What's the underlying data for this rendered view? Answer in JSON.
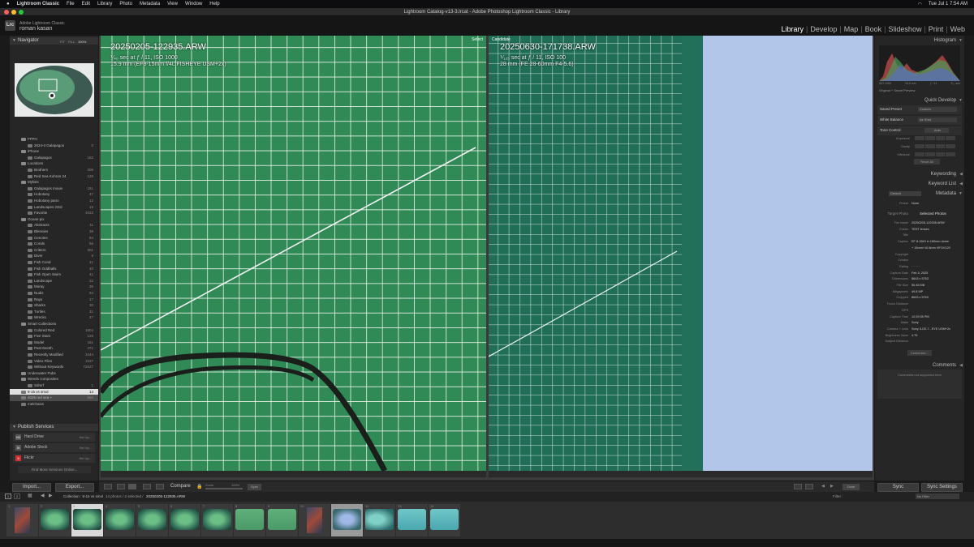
{
  "menubar": {
    "app": "Lightroom Classic",
    "items": [
      "File",
      "Edit",
      "Library",
      "Photo",
      "Metadata",
      "View",
      "Window",
      "Help"
    ],
    "clock": "Tue Jul 1  7:54 AM"
  },
  "window": {
    "title": "Lightroom Catalog-v13-3.lrcat - Adobe Photoshop Lightroom Classic - Library"
  },
  "identity": {
    "line1": "Adobe Lightroom Classic",
    "line2": "roman kasan"
  },
  "modules": [
    "Library",
    "Develop",
    "Map",
    "Book",
    "Slideshow",
    "Print",
    "Web"
  ],
  "active_module": "Library",
  "navigator": {
    "title": "Navigator",
    "zoom_opts": [
      "FIT",
      "FILL",
      "100%"
    ]
  },
  "collections": [
    {
      "label": "FFPH",
      "count": "",
      "indent": 1,
      "folder": true
    },
    {
      "label": "2024-II Galapagos",
      "count": "0",
      "indent": 2
    },
    {
      "label": "iPhone",
      "count": "",
      "indent": 1,
      "folder": true
    },
    {
      "label": "Galapagos",
      "count": "182",
      "indent": 2
    },
    {
      "label": "Locations",
      "count": "",
      "indent": 1,
      "folder": true
    },
    {
      "label": "Brothers",
      "count": "306",
      "indent": 2
    },
    {
      "label": "Red Sea Kohran 24",
      "count": "128",
      "indent": 2
    },
    {
      "label": "Mylists",
      "count": "",
      "indent": 1,
      "folder": true
    },
    {
      "label": "Galapagos movie",
      "count": "151",
      "indent": 2
    },
    {
      "label": "Hobotany",
      "count": "47",
      "indent": 2
    },
    {
      "label": "Hobotany pano",
      "count": "12",
      "indent": 2
    },
    {
      "label": "Landscapes 23rd",
      "count": "19",
      "indent": 2
    },
    {
      "label": "Favorite",
      "count": "4022",
      "indent": 2
    },
    {
      "label": "Ocean-pix",
      "count": "",
      "indent": 1,
      "folder": true
    },
    {
      "label": "Abstracts",
      "count": "11",
      "indent": 2
    },
    {
      "label": "Blennies",
      "count": "38",
      "indent": 2
    },
    {
      "label": "Cenotes",
      "count": "84",
      "indent": 2
    },
    {
      "label": "Corals",
      "count": "56",
      "indent": 2
    },
    {
      "label": "Critters",
      "count": "301",
      "indent": 2
    },
    {
      "label": "Diver",
      "count": "9",
      "indent": 2
    },
    {
      "label": "Fish Coral",
      "count": "41",
      "indent": 2
    },
    {
      "label": "Fish Oddballs",
      "count": "40",
      "indent": 2
    },
    {
      "label": "Fish Open Swim",
      "count": "41",
      "indent": 2
    },
    {
      "label": "Landscape",
      "count": "22",
      "indent": 2
    },
    {
      "label": "Moray",
      "count": "36",
      "indent": 2
    },
    {
      "label": "Nudis",
      "count": "94",
      "indent": 2
    },
    {
      "label": "Rays",
      "count": "17",
      "indent": 2
    },
    {
      "label": "Sharks",
      "count": "30",
      "indent": 2
    },
    {
      "label": "Turtles",
      "count": "31",
      "indent": 2
    },
    {
      "label": "Wrecks",
      "count": "47",
      "indent": 2
    },
    {
      "label": "Smart Collections",
      "count": "",
      "indent": 1,
      "folder": true
    },
    {
      "label": "Colored Red",
      "count": "1604",
      "indent": 2
    },
    {
      "label": "Five Stars",
      "count": "126",
      "indent": 2
    },
    {
      "label": "Model",
      "count": "161",
      "indent": 2
    },
    {
      "label": "Past Month",
      "count": "471",
      "indent": 2
    },
    {
      "label": "Recently Modified",
      "count": "3444",
      "indent": 2
    },
    {
      "label": "Video Files",
      "count": "1037",
      "indent": 2
    },
    {
      "label": "Without Keywords",
      "count": "72627",
      "indent": 2
    },
    {
      "label": "Underwater Pubs",
      "count": "",
      "indent": 1,
      "folder": true
    },
    {
      "label": "Weeds composites",
      "count": "",
      "indent": 1,
      "folder": true
    },
    {
      "label": "Sdmrf",
      "count": "1",
      "indent": 2
    },
    {
      "label": "8-15 vs smol",
      "count": "14",
      "indent": 1,
      "selected": true
    },
    {
      "label": "2025 red sea +",
      "count": "556",
      "indent": 1,
      "highlight": true
    },
    {
      "label": "melchaiss",
      "count": "",
      "indent": 1
    }
  ],
  "publish": {
    "title": "Publish Services",
    "services": [
      {
        "icon": "HD",
        "label": "Hard Drive",
        "setup": "Set Up..."
      },
      {
        "icon": "St",
        "label": "Adobe Stock",
        "setup": "Set Up..."
      },
      {
        "icon": "fl",
        "label": "Flickr",
        "setup": "Set Up..."
      }
    ],
    "find_more": "Find More Services Online..."
  },
  "import_btn": "Import...",
  "export_btn": "Export...",
  "select_image": {
    "name": "20250205-122935.ARW",
    "exposure": "⅟₄₀ sec at ƒ / 11, ISO 1000",
    "lens": "15.9 mm (EF8-15mm f/4L FISHEYE USM+2x)",
    "tag": "Select"
  },
  "candidate_image": {
    "name": "20250630-171738.ARW",
    "exposure": "⅟₁₂₅ sec at ƒ / 11, ISO 100",
    "lens": "28 mm (FE 28-60mm F4-5.6)",
    "tag": "Candidate"
  },
  "toolbar": {
    "compare": "Compare",
    "zoom": "Zoom",
    "zoom_value": "100%",
    "sync": "Sync",
    "done": "Done"
  },
  "histogram": {
    "title": "Histogram",
    "nums": [
      "ISO 1000",
      "15.9 mm",
      "ƒ / 11",
      "⅟₄₀ sec"
    ],
    "preview": "Original + Smart Preview"
  },
  "quick_develop": {
    "title": "Quick Develop",
    "saved_preset_label": "Saved Preset",
    "saved_preset": "Custom",
    "wb_label": "White Balance",
    "wb": "As Shot",
    "tone_label": "Tone Control",
    "tone_btn": "Auto",
    "adjust": [
      "Exposure",
      "Clarity",
      "Vibrance"
    ],
    "reset": "Reset All"
  },
  "keywording": "Keywording",
  "keyword_list": "Keyword List",
  "metadata": {
    "title": "Metadata",
    "preset": "Default",
    "preset_label": "Preset",
    "preset_value": "None",
    "target_label": "Target Photo",
    "target_value": "Selected Photos",
    "rows": [
      {
        "k": "File Name",
        "v": "20250205-122935.ARW"
      },
      {
        "k": "Folder",
        "v": "TEST lenses"
      },
      {
        "k": "Title",
        "v": ""
      },
      {
        "k": "Caption",
        "v": "EF 8-15f/4 in 180mm dome"
      },
      {
        "k": "",
        "v": "+ 15mm+10.6mm HFOV120"
      },
      {
        "k": "Copyright",
        "v": ""
      },
      {
        "k": "Creator",
        "v": ""
      },
      {
        "k": "Rating",
        "v": "· · · · ·"
      },
      {
        "k": "Capture Date",
        "v": "Feb 5, 2025"
      },
      {
        "k": "Dimensions",
        "v": "8643 x 5763"
      },
      {
        "k": "File Size",
        "v": "50.46 MB"
      },
      {
        "k": "Megapixels",
        "v": "49.8 MP"
      },
      {
        "k": "Cropped",
        "v": "8643 x 5763"
      },
      {
        "k": "Focus Distance",
        "v": ""
      },
      {
        "k": "GPS",
        "v": ""
      },
      {
        "k": "Capture Time",
        "v": "12:29:35 PM"
      },
      {
        "k": "Make",
        "v": "Sony"
      },
      {
        "k": "Camera + Lens",
        "v": "Sony ILCE-7...EYE USM+2x"
      },
      {
        "k": "Brightness Value",
        "v": "4.75"
      },
      {
        "k": "Subject Distance",
        "v": ""
      }
    ],
    "customize": "Customize..."
  },
  "comments": {
    "title": "Comments",
    "placeholder": "Comments not supported here"
  },
  "sync_btn": "Sync",
  "sync_settings_btn": "Sync Settings",
  "filmstrip": {
    "pages": [
      "1",
      "2"
    ],
    "source": "Collection : 8-15 vs smol",
    "counts": "14 photos / 2 selected /",
    "filename": "20250205-122935.ARW",
    "filter_label": "Filter :",
    "filter_value": "No Filter",
    "cells": [
      {
        "num": "1",
        "kind": "poster"
      },
      {
        "num": "2",
        "kind": "green"
      },
      {
        "num": "3",
        "kind": "green",
        "state": "sel"
      },
      {
        "num": "4",
        "kind": "green"
      },
      {
        "num": "5",
        "kind": "green"
      },
      {
        "num": "6",
        "kind": "green"
      },
      {
        "num": "7",
        "kind": "green"
      },
      {
        "num": "8",
        "kind": "greenflat"
      },
      {
        "num": "9",
        "kind": "greenflat"
      },
      {
        "num": "10",
        "kind": "poster"
      },
      {
        "num": "11",
        "kind": "blue",
        "state": "cand"
      },
      {
        "num": "12",
        "kind": "teal"
      },
      {
        "num": "13",
        "kind": "cyan"
      },
      {
        "num": "14",
        "kind": "cyan"
      }
    ]
  }
}
